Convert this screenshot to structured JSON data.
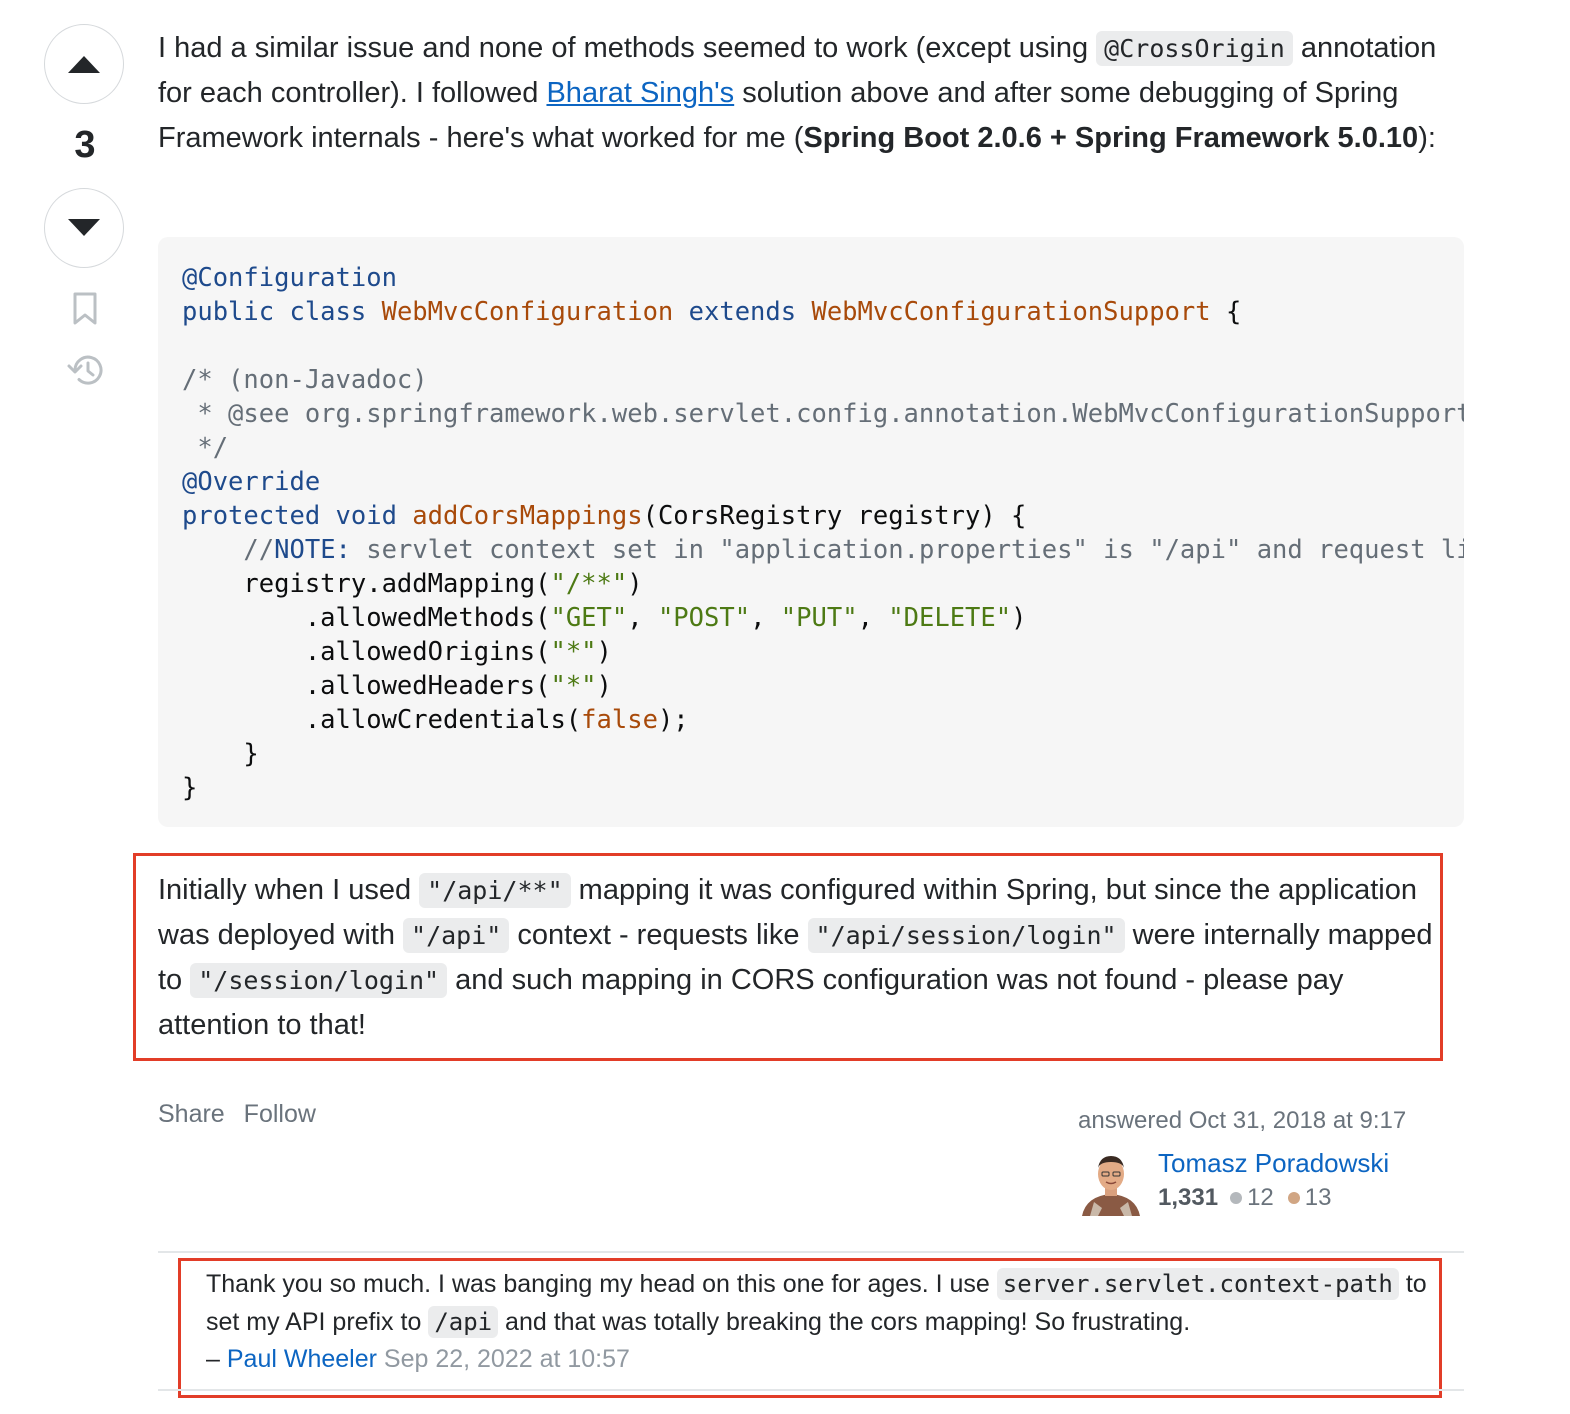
{
  "vote": {
    "count": "3"
  },
  "icons": {
    "upvote": "triangle-up-icon",
    "downvote": "triangle-down-icon",
    "bookmark": "bookmark-icon",
    "history": "history-icon"
  },
  "intro": {
    "t1": "I had a similar issue and none of methods seemed to work (except using ",
    "code1": "@CrossOrigin",
    "t2": " annotation for each controller). I followed ",
    "link": "Bharat Singh's",
    "t3": " solution above and after some debugging of Spring Framework internals - here's what worked for me (",
    "bold": "Spring Boot 2.0.6 + Spring Framework 5.0.10",
    "t4": "):"
  },
  "code": {
    "l1_annotation": "@Configuration",
    "l2_kw": "public class ",
    "l2_class": "WebMvcConfiguration",
    "l2_extends": " extends ",
    "l2_super": "WebMvcConfigurationSupport",
    "l2_end": " {",
    "l4_comment": "/* (non-Javadoc)",
    "l5_comment": " * @see org.springframework.web.servlet.config.annotation.WebMvcConfigurationSupport#addCorsMappings(org.springframework.web.servlet.config.annotation.CorsRegistry)",
    "l6_comment": " */",
    "l7_annotation": "@Override",
    "l8_kw": "protected void ",
    "l8_fn": "addCorsMappings",
    "l8_rest": "(CorsRegistry registry) {",
    "l9_indent": "    ",
    "l9_comment_a": "//",
    "l9_note": "NOTE:",
    "l9_comment_b": " servlet context set in \"application.properties\" is \"/api\" and request like \"/api/session/login\" resolves here to \"/session/login\"!",
    "l10_a": "    registry.addMapping(",
    "l10_str": "\"/**\"",
    "l10_b": ")",
    "l11_a": "        .allowedMethods(",
    "l11_s1": "\"GET\"",
    "l11_c1": ", ",
    "l11_s2": "\"POST\"",
    "l11_c2": ", ",
    "l11_s3": "\"PUT\"",
    "l11_c3": ", ",
    "l11_s4": "\"DELETE\"",
    "l11_b": ")",
    "l12_a": "        .allowedOrigins(",
    "l12_str": "\"*\"",
    "l12_b": ")",
    "l13_a": "        .allowedHeaders(",
    "l13_str": "\"*\"",
    "l13_b": ")",
    "l14_a": "        .allowCredentials(",
    "l14_lit": "false",
    "l14_b": ");",
    "l15": "    }",
    "l16": "}"
  },
  "note": {
    "t1": "Initially when I used ",
    "c1": "\"/api/**\"",
    "t2": " mapping it was configured within Spring, but since the application was deployed with ",
    "c2": "\"/api\"",
    "t3": " context - requests like ",
    "c3": "\"/api/session/login\"",
    "t4": " were internally mapped to ",
    "c4": "\"/session/login\"",
    "t5": " and such mapping in CORS configuration was not found - please pay attention to that!"
  },
  "post_menu": {
    "share": "Share",
    "follow": "Follow"
  },
  "signature": {
    "answered": "answered Oct 31, 2018 at 9:17",
    "user_name": "Tomasz Poradowski",
    "reputation": "1,331",
    "silver_badges": "12",
    "bronze_badges": "13",
    "silver_color": "#b4b8bc",
    "bronze_color": "#d1a684"
  },
  "comment": {
    "t1": "Thank you so much. I was banging my head on this one for ages. I use ",
    "c1": "server.servlet.context-path",
    "t2": " to set my API prefix to ",
    "c2": "/api",
    "t3": " and that was totally breaking the cors mapping! So frustrating.",
    "dash": " – ",
    "user": "Paul Wheeler",
    "date": "Sep 22, 2022 at 10:57"
  },
  "colors": {
    "highlight_border": "#e23d28",
    "link": "#0c65c2",
    "code_bg": "#f6f6f6"
  }
}
